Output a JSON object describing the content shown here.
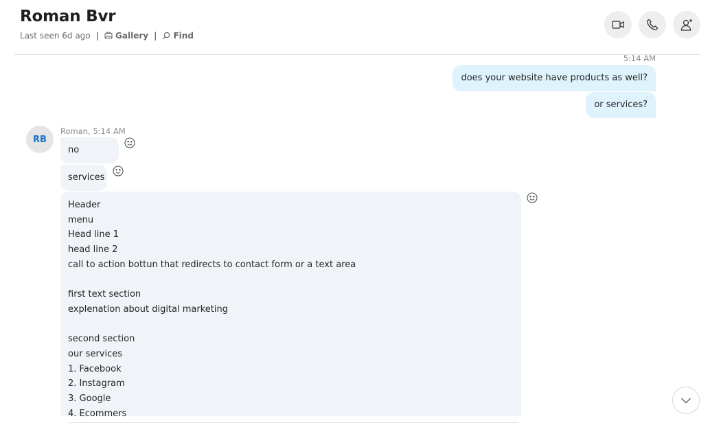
{
  "header": {
    "contact_name": "Roman Bvr",
    "last_seen": "Last seen 6d ago",
    "separator": "|",
    "gallery_label": "Gallery",
    "find_label": "Find"
  },
  "icons": {
    "video": "video-camera-icon",
    "call": "phone-icon",
    "add_people": "add-person-icon",
    "gallery": "gallery-icon",
    "find": "search-icon",
    "react": "smiley-icon",
    "scroll": "chevron-down-icon"
  },
  "colors": {
    "outgoing_bubble": "#dff3fc",
    "incoming_bubble": "#f0f4f8",
    "avatar_initials": "#1a73c6"
  },
  "conversation": {
    "outgoing": {
      "timestamp": "5:14 AM",
      "messages": [
        "does your website have products as well?",
        "or services?"
      ]
    },
    "incoming": {
      "avatar_initials": "RB",
      "sender_time": "Roman, 5:14 AM",
      "messages": [
        "no",
        "services"
      ],
      "long_message_lines": [
        "Header",
        "menu",
        "Head line 1",
        "head line 2",
        "call to action bottun that redirects to contact form or a text area",
        "",
        "first text section",
        "explenation about digital marketing",
        "",
        "second section",
        "our services",
        "1. Facebook",
        "2. Instagram",
        "3. Google",
        "4. Ecommers"
      ]
    }
  }
}
